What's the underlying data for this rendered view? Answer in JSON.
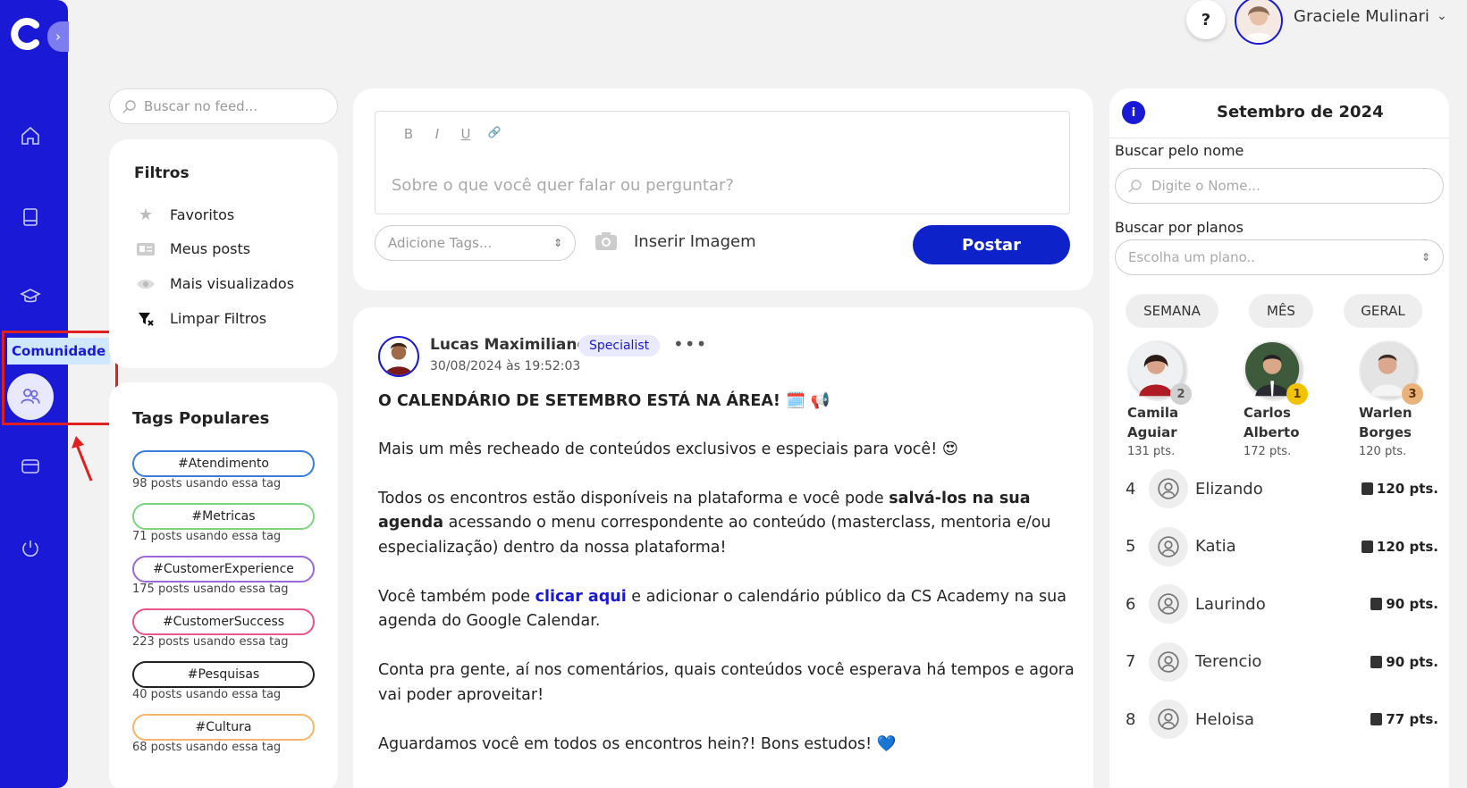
{
  "sidebar": {
    "community_label": "Comunidade"
  },
  "header": {
    "help_label": "?",
    "user_name": "Graciele Mulinari"
  },
  "feed_search": {
    "placeholder": "Buscar no feed..."
  },
  "filters": {
    "title": "Filtros",
    "items": [
      {
        "label": "Favoritos",
        "icon": "star-icon"
      },
      {
        "label": "Meus posts",
        "icon": "id-card-icon"
      },
      {
        "label": "Mais visualizados",
        "icon": "eye-icon"
      },
      {
        "label": "Limpar Filtros",
        "icon": "clear-filter-icon"
      }
    ]
  },
  "popular_tags": {
    "title": "Tags Populares",
    "tags": [
      {
        "label": "#Atendimento",
        "count": "98 posts usando essa tag",
        "color": "#3b7ddd"
      },
      {
        "label": "#Metricas",
        "count": "71 posts usando essa tag",
        "color": "#7ed37e"
      },
      {
        "label": "#CustomerExperience",
        "count": "175 posts usando essa tag",
        "color": "#9a6bd8"
      },
      {
        "label": "#CustomerSuccess",
        "count": "223 posts usando essa tag",
        "color": "#e7548a"
      },
      {
        "label": "#Pesquisas",
        "count": "40 posts usando essa tag",
        "color": "#222222"
      },
      {
        "label": "#Cultura",
        "count": "68 posts usando essa tag",
        "color": "#f5b56a"
      }
    ]
  },
  "composer": {
    "toolbar": [
      "B",
      "I",
      "U",
      "🔗"
    ],
    "placeholder": "Sobre o que você quer falar ou perguntar?",
    "tags_placeholder": "Adicione Tags...",
    "insert_image": "Inserir Imagem",
    "post_button": "Postar"
  },
  "post": {
    "author": "Lucas Maximiliano",
    "badge": "Specialist",
    "more": "•••",
    "date": "30/08/2024 às 19:52:03",
    "title": "O CALENDÁRIO DE SETEMBRO ESTÁ NA ÁREA! 🗓️ 📢",
    "p1": "Mais um mês recheado de conteúdos exclusivos e especiais para você! 😍",
    "p2_a": "Todos os encontros estão disponíveis na plataforma e você pode ",
    "p2_bold": "salvá-los na sua agenda",
    "p2_b": " acessando o menu correspondente ao conteúdo (masterclass, mentoria e/ou especialização) dentro da nossa plataforma!",
    "p3_a": "Você também pode ",
    "p3_link": "clicar aqui",
    "p3_b": " e adicionar o calendário público da CS Academy na sua agenda do Google Calendar.",
    "p4": "Conta pra gente, aí nos comentários, quais conteúdos você esperava há tempos e agora vai poder aproveitar!",
    "p5": "Aguardamos você em todos os encontros hein?! Bons estudos! 💙"
  },
  "ranking": {
    "info": "i",
    "title": "Setembro de 2024",
    "search_label": "Buscar pelo nome",
    "search_placeholder": "Digite o Nome...",
    "plan_label": "Buscar por planos",
    "plan_placeholder": "Escolha um plano..",
    "tabs": [
      "SEMANA",
      "MÊS",
      "GERAL"
    ],
    "podium": [
      {
        "first": "Camila",
        "last": "Aguiar",
        "pts": "131 pts.",
        "pos": "2",
        "badge_color": "#d0d0d0"
      },
      {
        "first": "Carlos",
        "last": "Alberto",
        "pts": "172 pts.",
        "pos": "1",
        "badge_color": "#f2c200"
      },
      {
        "first": "Warlen",
        "last": "Borges",
        "pts": "120 pts.",
        "pos": "3",
        "badge_color": "#e9b27a"
      }
    ],
    "rows": [
      {
        "pos": "4",
        "name": "Elizando",
        "pts": "120 pts."
      },
      {
        "pos": "5",
        "name": "Katia",
        "pts": "120 pts."
      },
      {
        "pos": "6",
        "name": "Laurindo",
        "pts": "90 pts."
      },
      {
        "pos": "7",
        "name": "Terencio",
        "pts": "90 pts."
      },
      {
        "pos": "8",
        "name": "Heloisa",
        "pts": "77 pts."
      }
    ]
  }
}
